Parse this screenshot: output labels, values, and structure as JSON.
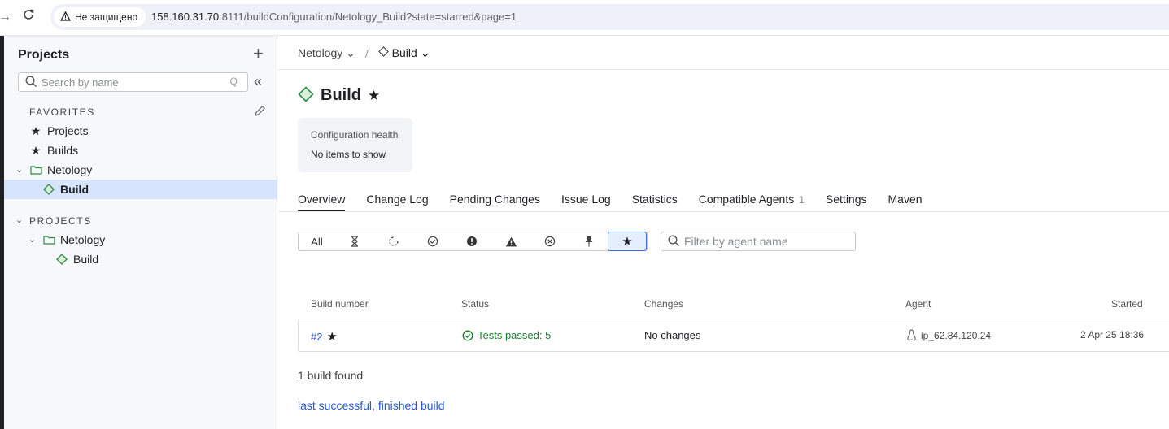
{
  "browser": {
    "security_label": "Не защищено",
    "url_host": "158.160.31.70",
    "url_rest": ":8111/buildConfiguration/Netology_Build?state=starred&page=1"
  },
  "sidebar": {
    "title": "Projects",
    "search_placeholder": "Search by name",
    "favorites_heading": "FAVORITES",
    "favorites": [
      {
        "label": "Projects",
        "icon": "star-icon"
      },
      {
        "label": "Builds",
        "icon": "star-icon"
      },
      {
        "label": "Netology",
        "icon": "folder-icon"
      },
      {
        "label": "Build",
        "icon": "diamond-icon"
      }
    ],
    "projects_heading": "PROJECTS",
    "projects": [
      {
        "label": "Netology",
        "icon": "folder-icon"
      },
      {
        "label": "Build",
        "icon": "diamond-icon"
      }
    ]
  },
  "breadcrumb": {
    "project": "Netology",
    "config": "Build"
  },
  "page": {
    "title": "Build",
    "health_title": "Configuration health",
    "health_value": "No items to show"
  },
  "tabs": [
    {
      "label": "Overview",
      "active": true
    },
    {
      "label": "Change Log"
    },
    {
      "label": "Pending Changes"
    },
    {
      "label": "Issue Log"
    },
    {
      "label": "Statistics"
    },
    {
      "label": "Compatible Agents",
      "count": "1"
    },
    {
      "label": "Settings"
    },
    {
      "label": "Maven"
    }
  ],
  "filters": {
    "all_label": "All",
    "icons": [
      "hourglass-icon",
      "running-icon",
      "success-icon",
      "failed-icon",
      "warning-icon",
      "canceled-icon",
      "pin-icon",
      "star-icon"
    ],
    "selected": "star-icon",
    "agent_placeholder": "Filter by agent name"
  },
  "table": {
    "headers": {
      "build_number": "Build number",
      "status": "Status",
      "changes": "Changes",
      "agent": "Agent",
      "started": "Started"
    },
    "rows": [
      {
        "number": "#2",
        "status": "Tests passed: 5",
        "changes": "No changes",
        "agent": "ip_62.84.120.24",
        "started": "2 Apr 25 18:36"
      }
    ]
  },
  "summary": {
    "count_text": "1 build found",
    "last_link": "last successful, finished build"
  },
  "colors": {
    "accent": "#3b73e6",
    "success": "#1c7a2c",
    "diamond": "#2f8a44",
    "selected_row": "#d6e4fd"
  }
}
